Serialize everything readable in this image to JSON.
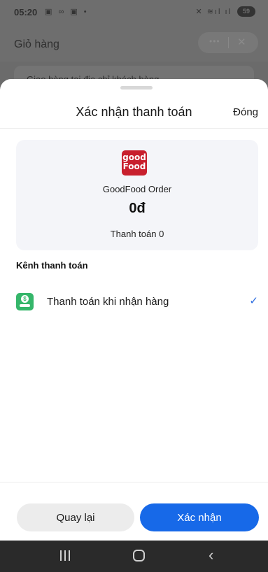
{
  "status": {
    "time": "05:20",
    "left_icons": "▣ ∞ ▣ •",
    "right_icons": "✕ ≋ıl ıl",
    "battery": "59"
  },
  "background": {
    "title": "Giỏ hàng",
    "card_text": "Giao hàng tại địa chỉ khách hàng"
  },
  "sheet": {
    "title": "Xác nhận thanh toán",
    "close_label": "Đóng",
    "merchant_logo": {
      "line1": "good",
      "line2": "Food",
      "color": "#c81f2d"
    },
    "merchant_name": "GoodFood Order",
    "amount": "0đ",
    "payment_subtitle": "Thanh toán 0",
    "channel_heading": "Kênh thanh toán",
    "methods": [
      {
        "label": "Thanh toán khi nhận hàng",
        "icon": "cash-on-delivery-icon",
        "selected": true
      }
    ],
    "back_label": "Quay lại",
    "confirm_label": "Xác nhận"
  },
  "colors": {
    "accent": "#1769e8",
    "check": "#2a6be0",
    "cod_icon": "#35b66a"
  },
  "navigation_icons": [
    "recent-apps-icon",
    "home-icon",
    "back-icon"
  ]
}
